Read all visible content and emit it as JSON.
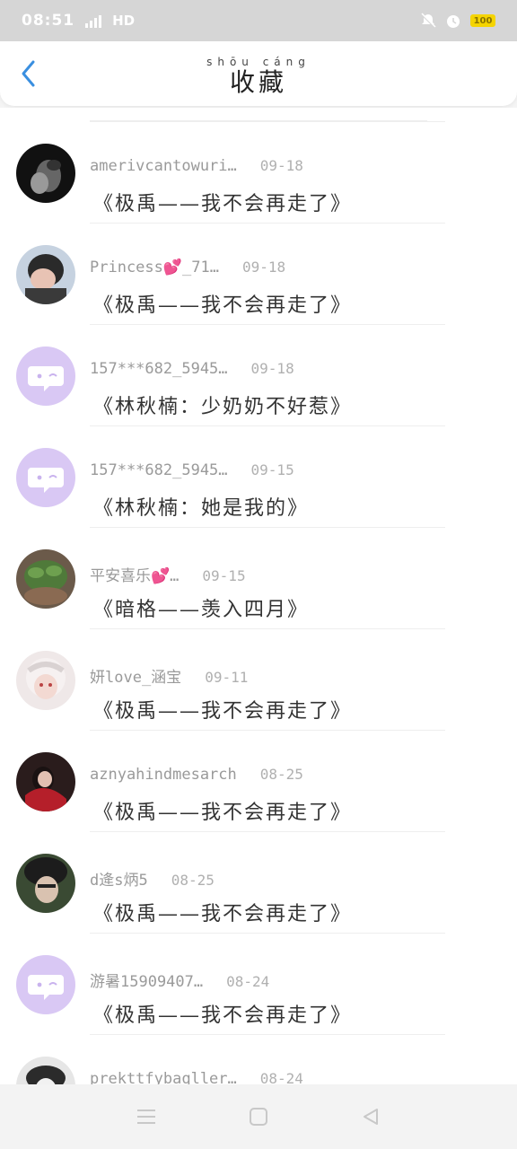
{
  "status_bar": {
    "time": "08:51",
    "network": "HD",
    "battery": "100",
    "icons": [
      "signal-icon",
      "mute-icon",
      "alarm-icon",
      "battery-icon"
    ]
  },
  "header": {
    "title": "收藏",
    "title_pinyin": "shōu cáng",
    "back_icon": "chevron-left-icon"
  },
  "colors": {
    "accent": "#3a8fe0",
    "default_avatar_bg": "#d9c8f4",
    "default_avatar_icon": "#ffffff"
  },
  "favorites": [
    {
      "name": "amerivcantowuri…",
      "date": "09-18",
      "text": "《极禹——我不会再走了》",
      "avatar": "photo-dark"
    },
    {
      "name": "Princess💕_71…",
      "date": "09-18",
      "text": "《极禹——我不会再走了》",
      "avatar": "photo-girl"
    },
    {
      "name": "157***682_5945…",
      "date": "09-18",
      "text": "《林秋楠：少奶奶不好惹》",
      "avatar": "default-chat"
    },
    {
      "name": "157***682_5945…",
      "date": "09-15",
      "text": "《林秋楠：她是我的》",
      "avatar": "default-chat"
    },
    {
      "name": "平安喜乐💕…",
      "date": "09-15",
      "text": "《暗格——羡入四月》",
      "avatar": "photo-plant"
    },
    {
      "name": "妍love_涵宝",
      "date": "09-11",
      "text": "《极禹——我不会再走了》",
      "avatar": "photo-anime"
    },
    {
      "name": "aznyahindmesarch",
      "date": "08-25",
      "text": "《极禹——我不会再走了》",
      "avatar": "photo-red"
    },
    {
      "name": "d逄s炳5",
      "date": "08-25",
      "text": "《极禹——我不会再走了》",
      "avatar": "photo-boy"
    },
    {
      "name": "游暑15909407…",
      "date": "08-24",
      "text": "《极禹——我不会再走了》",
      "avatar": "default-chat"
    },
    {
      "name": "prekttfybaqller…",
      "date": "08-24",
      "text": "",
      "avatar": "photo-bw"
    }
  ],
  "nav_bar": {
    "buttons": [
      "menu-icon",
      "home-icon",
      "back-triangle-icon"
    ]
  }
}
